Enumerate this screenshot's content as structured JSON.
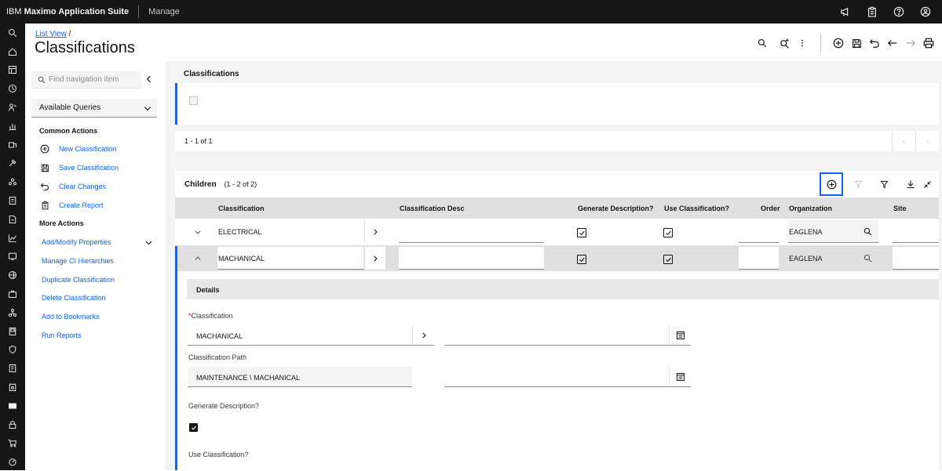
{
  "topbar": {
    "brand_prefix": "IBM",
    "brand_name": "Maximo Application Suite",
    "app_name": "Manage",
    "icons": [
      "megaphone-icon",
      "clipboard-icon",
      "help-icon",
      "user-icon"
    ]
  },
  "rail": {
    "icons": [
      "search-icon",
      "home-icon",
      "dashboard-icon",
      "history-icon",
      "people-icon",
      "chart-icon",
      "asset-icon",
      "tool-icon",
      "group-icon",
      "workorder-icon",
      "document-icon",
      "analytics-icon",
      "monitor-icon",
      "globe-icon",
      "briefcase-icon",
      "tree-icon",
      "meter-icon",
      "shield-icon",
      "report-icon",
      "inventory-icon",
      "card-icon",
      "lock-icon",
      "cart-icon",
      "gauge-icon"
    ]
  },
  "header": {
    "breadcrumb_link": "List View",
    "breadcrumb_sep": "/",
    "title": "Classifications"
  },
  "nav": {
    "search_placeholder": "Find navigation item",
    "queries_label": "Available Queries",
    "common_actions_title": "Common Actions",
    "common_actions": [
      "New Classification",
      "Save Classification",
      "Clear Changes",
      "Create Report"
    ],
    "more_actions_title": "More Actions",
    "more_actions": [
      "Add/Modify Properties",
      "Manage CI Hierarchies",
      "Duplicate Classification",
      "Delete Classification",
      "Add to Bookmarks",
      "Run Reports"
    ]
  },
  "list": {
    "tab_label": "Classifications",
    "pager_text": "1 - 1 of 1"
  },
  "children": {
    "title": "Children",
    "count": "(1 - 2 of 2)",
    "columns": [
      "Classification",
      "Classification Desc",
      "Generate Description?",
      "Use Classification?",
      "Order",
      "Organization",
      "Site"
    ],
    "rows": [
      {
        "classification": "ELECTRICAL",
        "desc": "",
        "generate_description": true,
        "use_classification": true,
        "order": "",
        "organization": "EAGLENA",
        "site": ""
      },
      {
        "classification": "MACHANICAL",
        "desc": "",
        "generate_description": true,
        "use_classification": true,
        "order": "",
        "organization": "EAGLENA",
        "site": ""
      }
    ]
  },
  "details": {
    "title": "Details",
    "classification_label": "Classification",
    "classification_value": "MACHANICAL",
    "path_label": "Classification Path",
    "path_value": "MAINTENANCE \\ MACHANICAL",
    "generate_label": "Generate Description?",
    "generate_value": true,
    "use_label": "Use Classification?"
  },
  "colors": {
    "accent": "#0f62fe",
    "topbar": "#161616",
    "required": "#da1e28"
  }
}
